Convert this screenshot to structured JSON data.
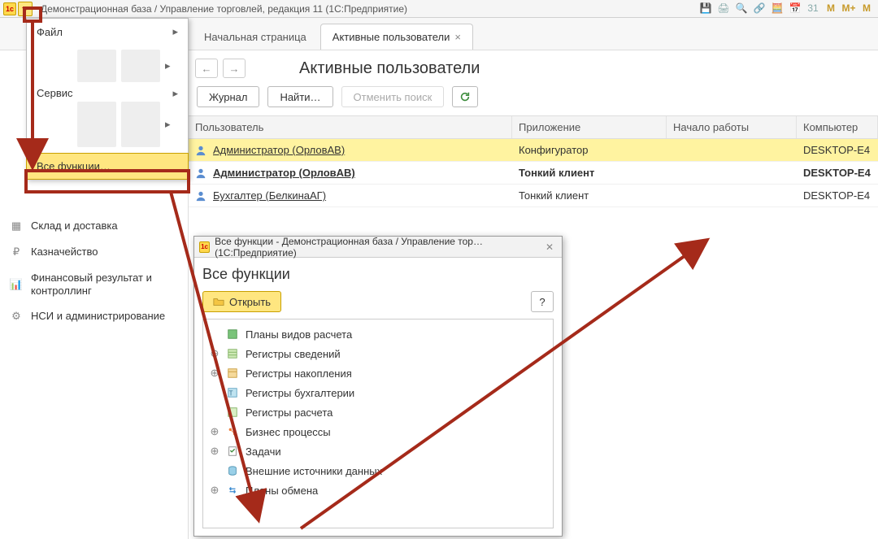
{
  "window_title": "Демонстрационная база / Управление торговлей, редакция 11 (1С:Предприятие)",
  "titlebar_right": [
    "M",
    "M+",
    "M"
  ],
  "menu": {
    "file": "Файл",
    "service": "Сервис",
    "all_functions": "Все функции…"
  },
  "sidebar": {
    "items": [
      {
        "label": "Склад и доставка"
      },
      {
        "label": "Казначейство"
      },
      {
        "label": "Финансовый результат и контроллинг"
      },
      {
        "label": "НСИ и администрирование"
      }
    ]
  },
  "tabs": {
    "start": "Начальная страница",
    "active_users": "Активные пользователи"
  },
  "page_title": "Активные пользователи",
  "toolbar": {
    "journal": "Журнал",
    "find": "Найти…",
    "cancel_search": "Отменить поиск"
  },
  "grid": {
    "headers": {
      "user": "Пользователь",
      "app": "Приложение",
      "start": "Начало работы",
      "computer": "Компьютер"
    },
    "rows": [
      {
        "user": "Администратор (ОрловАВ)",
        "app": "Конфигуратор",
        "computer": "DESKTOP-E4",
        "selected": true,
        "bold": false
      },
      {
        "user": "Администратор (ОрловАВ)",
        "app": "Тонкий клиент",
        "computer": "DESKTOP-E4",
        "bold": true
      },
      {
        "user": "Бухгалтер (БелкинаАГ)",
        "app": "Тонкий клиент",
        "computer": "DESKTOP-E4",
        "bold": false
      }
    ]
  },
  "dialog": {
    "title": "Все функции - Демонстрационная база / Управление тор… (1С:Предприятие)",
    "header": "Все функции",
    "open": "Открыть",
    "help": "?",
    "nodes": [
      "Планы видов расчета",
      "Регистры сведений",
      "Регистры накопления",
      "Регистры бухгалтерии",
      "Регистры расчета",
      "Бизнес процессы",
      "Задачи",
      "Внешние источники данных",
      "Планы обмена"
    ]
  }
}
